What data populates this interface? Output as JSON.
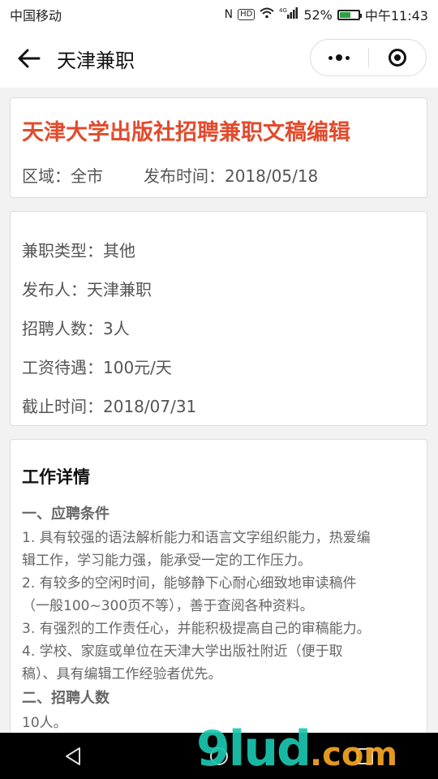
{
  "status": {
    "carrier": "中国移动",
    "network": "4G",
    "battery": "52%",
    "time": "中午11:43"
  },
  "nav": {
    "title": "天津兼职"
  },
  "job": {
    "title": "天津大学出版社招聘兼职文稿编辑",
    "area": "区域：全市",
    "publish_time": "发布时间：2018/05/18"
  },
  "info": [
    "兼职类型：其他",
    "发布人：天津兼职",
    "招聘人数：3人",
    "工资待遇：100元/天",
    "截止时间：2018/07/31"
  ],
  "detail": {
    "title": "工作详情",
    "section1": "一、应聘条件",
    "lines": [
      "1. 具有较强的语法解析能力和语言文字组织能力，热爱编",
      "辑工作，学习能力强，能承受一定的工作压力。",
      "2. 有较多的空闲时间，能够静下心耐心细致地审读稿件",
      "（一般100~300页不等），善于查阅各种资料。",
      "3. 有强烈的工作责任心，并能积极提高自己的审稿能力。",
      "4. 学校、家庭或单位在天津大学出版社附近（便于取",
      "稿）、具有编辑工作经验者优先。"
    ],
    "section2": "二、招聘人数",
    "count": "10人。"
  },
  "watermark": {
    "main": "9lud",
    "suffix": ".com"
  },
  "colors": {
    "accent": "#e24b2c",
    "watermark": "#1bc7b0"
  }
}
